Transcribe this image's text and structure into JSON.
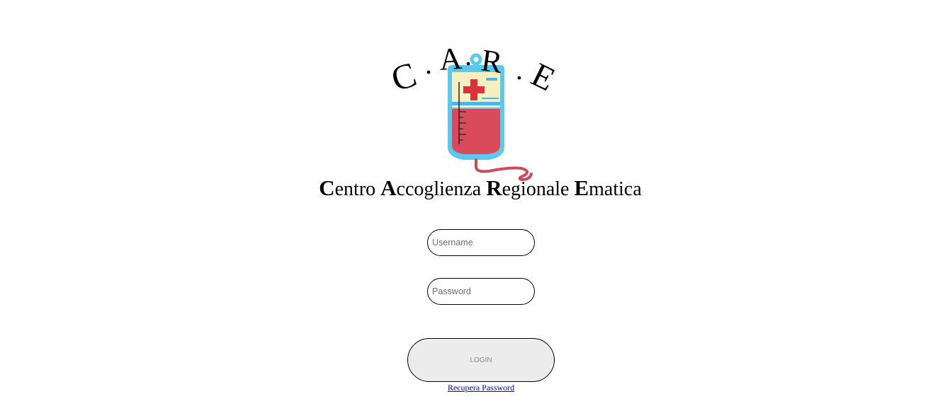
{
  "logo": {
    "letters": [
      "C",
      "A",
      "R",
      "E"
    ],
    "dots": [
      ".",
      ".",
      "."
    ],
    "icon": "blood-bag-icon",
    "colors": {
      "bag_outline": "#5bc8ee",
      "bag_top": "#f8efc0",
      "blood": "#d94b5a",
      "cross": "#d9333f",
      "stripe": "#4ab5e6",
      "tube": "#c94b5c"
    }
  },
  "subtitle": {
    "word1_cap": "C",
    "word1_rest": "entro",
    "word2_cap": "A",
    "word2_rest": "ccoglienza",
    "word3_cap": "R",
    "word3_rest": "egionale",
    "word4_cap": "E",
    "word4_rest": "matica"
  },
  "form": {
    "username_placeholder": "Username",
    "username_value": "",
    "password_placeholder": "Password",
    "password_value": "",
    "login_label": "LOGIN",
    "recover_label": "Recupera Password"
  }
}
